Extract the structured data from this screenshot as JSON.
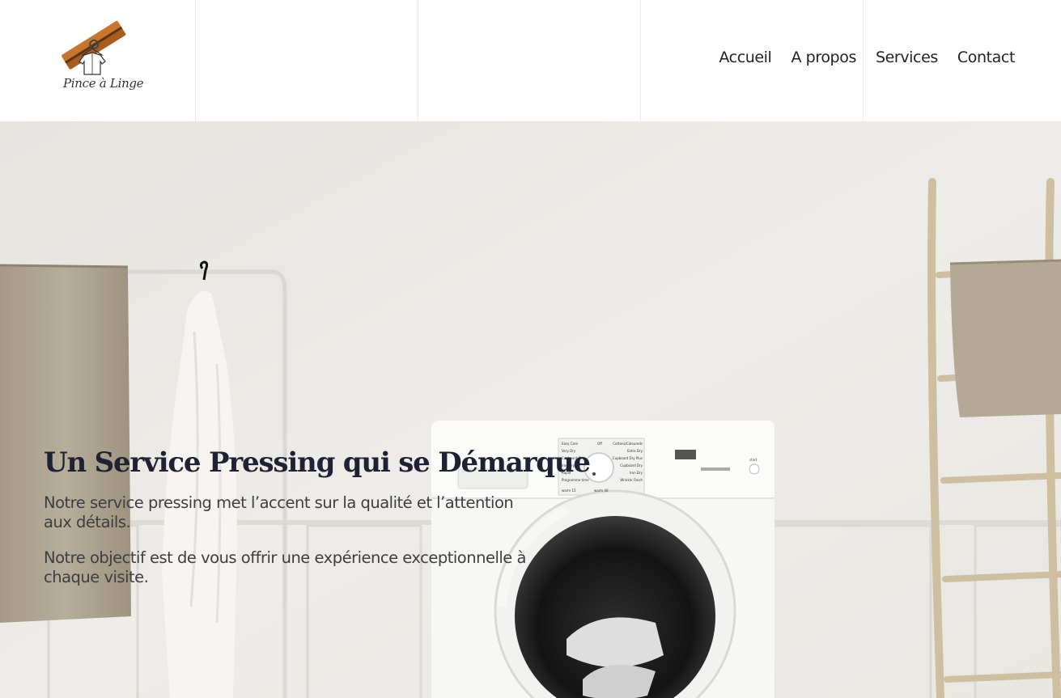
{
  "brand": {
    "logo_text": "Pince à Linge",
    "colors": {
      "clothespin": "#c8762c",
      "text": "#333333"
    }
  },
  "nav": {
    "items": [
      {
        "label": "Accueil"
      },
      {
        "label": "A propos"
      },
      {
        "label": "Services"
      },
      {
        "label": "Contact"
      }
    ]
  },
  "hero": {
    "title": "Un Service Pressing qui se Démarque",
    "paragraph_1": "Notre service pressing met l’accent sur la qualité et l’attention aux détails.",
    "paragraph_2": "Notre objectif est de vous offrir une expérience exceptionnelle à chaque visite.",
    "image_icon": "laundry-room-photo",
    "colors": {
      "title": "#1f2233",
      "body": "#3e3e42",
      "wall": "#ebe9e4"
    }
  },
  "machine_panel": {
    "labels_left": [
      "Easy Care",
      "Very Dry",
      "Cupboard Dry",
      "Iron Dry",
      "Rapid",
      "Programme time"
    ],
    "labels_right": [
      "Cottons/Coloureds",
      "Extra Dry",
      "Cupboard Dry Plus",
      "Cupboard Dry",
      "Iron Dry",
      "Wrinkle Finish"
    ],
    "label_off": "Off",
    "label_warm_left": "warm 15",
    "label_warm_right": "warm 40",
    "label_start": "start"
  }
}
